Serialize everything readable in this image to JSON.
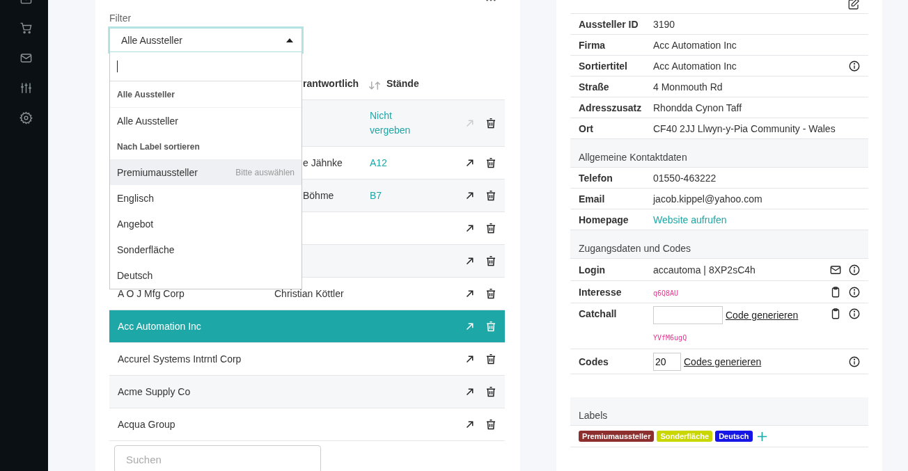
{
  "filter": {
    "label": "Filter",
    "value": "Alle Aussteller",
    "expanded": true
  },
  "dropdown": {
    "groups": [
      {
        "heading": "Alle Aussteller",
        "options": [
          {
            "label": "Alle Aussteller",
            "highlighted": false
          }
        ]
      },
      {
        "heading": "Nach Label sortieren",
        "options": [
          {
            "label": "Premiumaussteller",
            "highlighted": true,
            "hint": "Bitte auswählen"
          },
          {
            "label": "Englisch",
            "highlighted": false
          },
          {
            "label": "Angebot",
            "highlighted": false
          },
          {
            "label": "Sonderfläche",
            "highlighted": false
          },
          {
            "label": "Deutsch",
            "highlighted": false
          }
        ]
      }
    ]
  },
  "table": {
    "columns": [
      "rantwortlich",
      "Stände"
    ],
    "rows": [
      {
        "stands": "Nicht vergeben",
        "selected": false,
        "open_disabled": true
      },
      {
        "responsible": "e Jähnke",
        "stands": "A12",
        "selected": false,
        "open_disabled": false
      },
      {
        "responsible": "Böhme",
        "stands": "B7",
        "selected": false,
        "open_disabled": false
      },
      {
        "selected": false,
        "open_disabled": false
      },
      {
        "selected": false,
        "open_disabled": false
      },
      {
        "name": "A O J Mfg Corp",
        "responsible": "Christian Köttler",
        "selected": false,
        "open_disabled": false
      },
      {
        "name": "Acc Automation Inc",
        "selected": true,
        "open_disabled": false
      },
      {
        "name": "Accurel Systems Intrntl Corp",
        "selected": false,
        "open_disabled": false
      },
      {
        "name": "Acme Supply Co",
        "selected": false,
        "open_disabled": false
      },
      {
        "name": "Acqua Group",
        "selected": false,
        "open_disabled": false
      }
    ]
  },
  "search": {
    "placeholder": "Suchen"
  },
  "details": {
    "sections": [
      {
        "rows": [
          {
            "kind": "text",
            "label": "Aussteller ID",
            "value": "3190"
          },
          {
            "kind": "text",
            "label": "Firma",
            "value": "Acc Automation Inc"
          },
          {
            "kind": "info",
            "label": "Sortiertitel",
            "value": "Acc Automation Inc"
          },
          {
            "kind": "text",
            "label": "Straße",
            "value": "4 Monmouth Rd"
          },
          {
            "kind": "text",
            "label": "Adresszusatz",
            "value": "Rhondda Cynon Taff"
          },
          {
            "kind": "text",
            "label": "Ort",
            "value": "CF40 2JJ Llwyn-y-Pia Community - Wales"
          }
        ]
      },
      {
        "heading": "Allgemeine Kontaktdaten",
        "rows": [
          {
            "kind": "text",
            "label": "Telefon",
            "value": "01550-463222"
          },
          {
            "kind": "text",
            "label": "Email",
            "value": "jacob.kippel@yahoo.com"
          },
          {
            "kind": "link",
            "label": "Homepage",
            "value": "Website aufrufen"
          }
        ]
      },
      {
        "heading": "Zugangsdaten und Codes",
        "rows": [
          {
            "kind": "login",
            "label": "Login",
            "value": "accautoma | 8XP2sC4h"
          },
          {
            "kind": "code",
            "label": "Interesse",
            "code": "q6Q8AU"
          },
          {
            "kind": "catchall",
            "label": "Catchall",
            "action": "Code generieren",
            "code": "YVfM6ugQ"
          },
          {
            "kind": "codes",
            "label": "Codes",
            "value": "20",
            "action": "Codes generieren"
          }
        ]
      }
    ]
  },
  "labels": {
    "heading": "Labels",
    "items": [
      {
        "label": "Premiumaussteller",
        "color": "#8e2f2f"
      },
      {
        "label": "Sonderfläche",
        "color": "#c9d600"
      },
      {
        "label": "Deutsch",
        "color": "#1616e6"
      }
    ]
  }
}
